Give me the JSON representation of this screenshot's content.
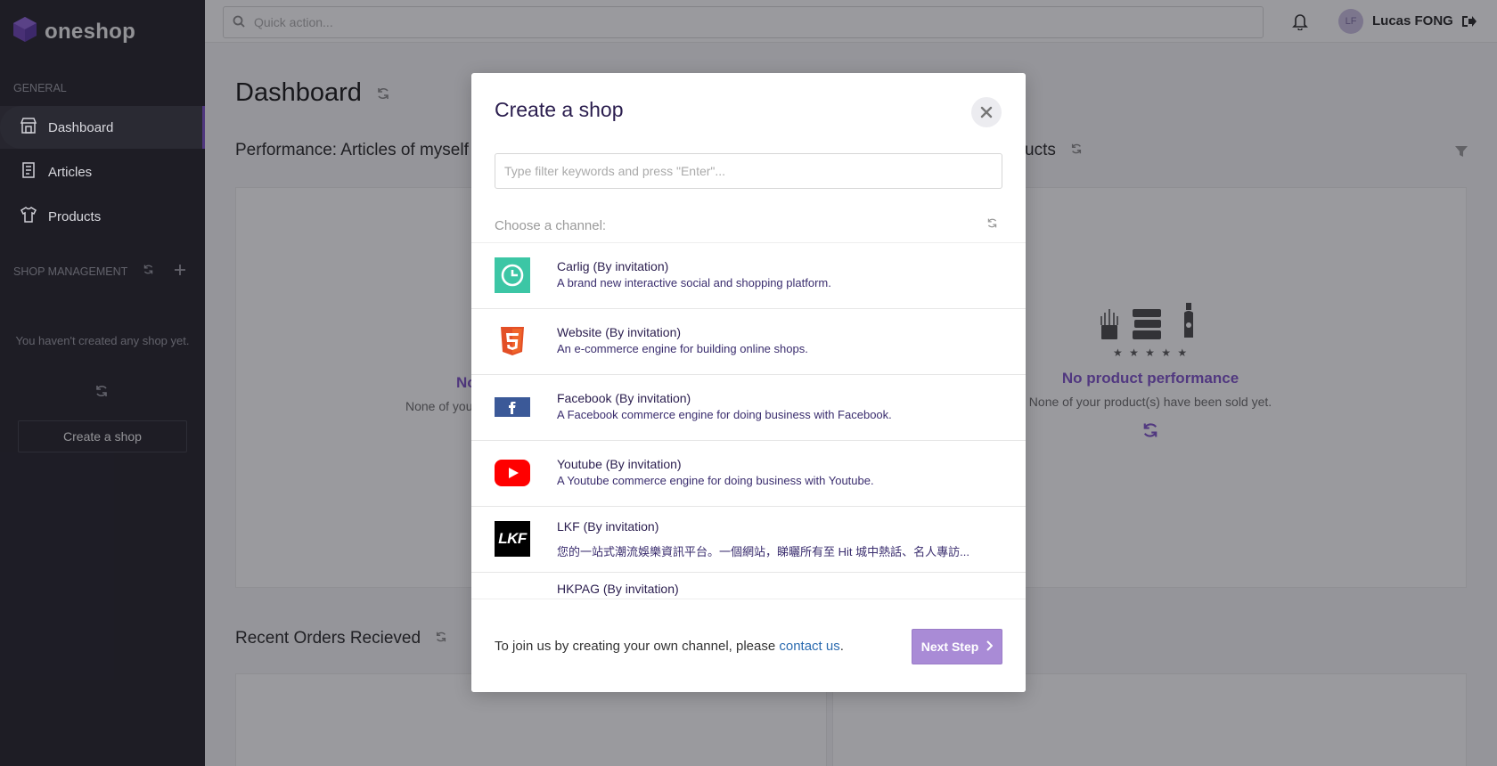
{
  "app": {
    "logo_text": "oneshop"
  },
  "sidebar": {
    "general_label": "GENERAL",
    "items": [
      {
        "label": "Dashboard",
        "icon": "store-icon",
        "active": true
      },
      {
        "label": "Articles",
        "icon": "document-icon",
        "active": false
      },
      {
        "label": "Products",
        "icon": "shirt-icon",
        "active": false
      }
    ],
    "shop_management_label": "SHOP MANAGEMENT",
    "empty_text": "You haven't created any shop yet.",
    "create_shop_label": "Create a shop"
  },
  "topbar": {
    "quick_action_placeholder": "Quick action...",
    "user_initials": "LF",
    "user_name": "Lucas FONG"
  },
  "main": {
    "page_title": "Dashboard",
    "performance_articles_title": "Performance: Articles of myself",
    "performance_products_title_fragment": "ucts",
    "left_placeholder_title_fragment": "No",
    "left_placeholder_sub_fragment": "None of you",
    "product_placeholder_title": "No product performance",
    "product_placeholder_sub": "None of your product(s) have been sold yet.",
    "stars": "★ ★ ★ ★ ★",
    "recent_orders_title": "Recent Orders Recieved"
  },
  "modal": {
    "title": "Create a shop",
    "filter_placeholder": "Type filter keywords and press \"Enter\"...",
    "choose_label": "Choose a channel:",
    "channels": [
      {
        "name": "Carlig (By invitation)",
        "desc": "A brand new interactive social and shopping platform.",
        "icon": "carlig-icon"
      },
      {
        "name": "Website (By invitation)",
        "desc": "An e-commerce engine for building online shops.",
        "icon": "html5-icon"
      },
      {
        "name": "Facebook (By invitation)",
        "desc": "A Facebook commerce engine for doing business with Facebook.",
        "icon": "facebook-icon"
      },
      {
        "name": "Youtube (By invitation)",
        "desc": "A Youtube commerce engine for doing business with Youtube.",
        "icon": "youtube-icon"
      },
      {
        "name": "LKF (By invitation)",
        "desc": "您的一站式潮流娛樂資訊平台。一個網站，睇曬所有至 Hit 城中熱話、名人專訪...",
        "icon": "lkf-icon",
        "icon_text": "LKF"
      },
      {
        "name": "HKPAG (By invitation)",
        "desc": "",
        "icon": "hkpag-icon"
      }
    ],
    "footer_text": "To join us by creating your own channel, please ",
    "footer_link": "contact us",
    "footer_end": ".",
    "next_label": "Next Step"
  },
  "colors": {
    "accent": "#7b4ec8",
    "sidebar_bg": "#1e1d24",
    "next_button": "#a98bd6",
    "link": "#2b6bb0"
  }
}
